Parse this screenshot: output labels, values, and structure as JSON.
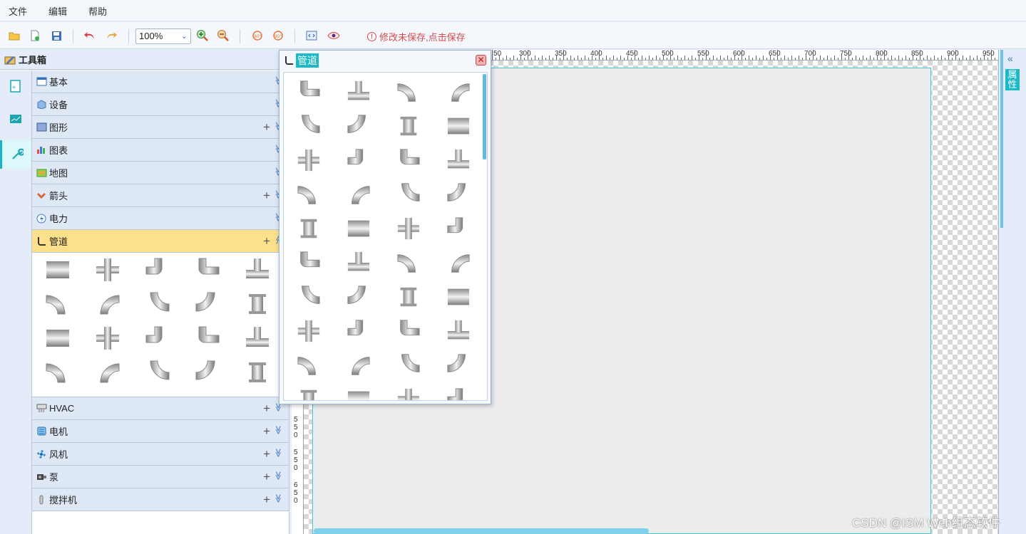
{
  "menu": {
    "file": "文件",
    "edit": "编辑",
    "help": "帮助"
  },
  "toolbar": {
    "zoom_value": "100%",
    "unsaved_notice": "修改未保存,点击保存"
  },
  "toolbox": {
    "title": "工具箱",
    "categories": [
      {
        "label": "基本",
        "plus": false
      },
      {
        "label": "设备",
        "plus": false
      },
      {
        "label": "图形",
        "plus": true
      },
      {
        "label": "图表",
        "plus": false
      },
      {
        "label": "地图",
        "plus": false
      },
      {
        "label": "箭头",
        "plus": true
      },
      {
        "label": "电力",
        "plus": false
      },
      {
        "label": "管道",
        "plus": true,
        "active": true
      },
      {
        "label": "HVAC",
        "plus": true
      },
      {
        "label": "电机",
        "plus": true
      },
      {
        "label": "风机",
        "plus": true
      },
      {
        "label": "泵",
        "plus": true
      },
      {
        "label": "搅拌机",
        "plus": true
      }
    ],
    "plus_symbol": "+",
    "chevron_symbol": "≫"
  },
  "popup": {
    "title": "管道",
    "close": "✕"
  },
  "ruler": {
    "top_labels": [
      "50",
      "300",
      "350",
      "400",
      "450",
      "500",
      "550",
      "600",
      "650",
      "700",
      "750",
      "800",
      "850",
      "900",
      "950"
    ],
    "left_digits": [
      "5",
      "5",
      "0",
      "5",
      "5",
      "0",
      "6",
      "5",
      "0"
    ]
  },
  "properties": {
    "toggle": "«",
    "label": "属性"
  },
  "watermark": "CSDN @ISM Web组态软件",
  "colors": {
    "accent": "#1bbac7",
    "active_category": "#fde08a",
    "warning": "#d84c4c"
  }
}
